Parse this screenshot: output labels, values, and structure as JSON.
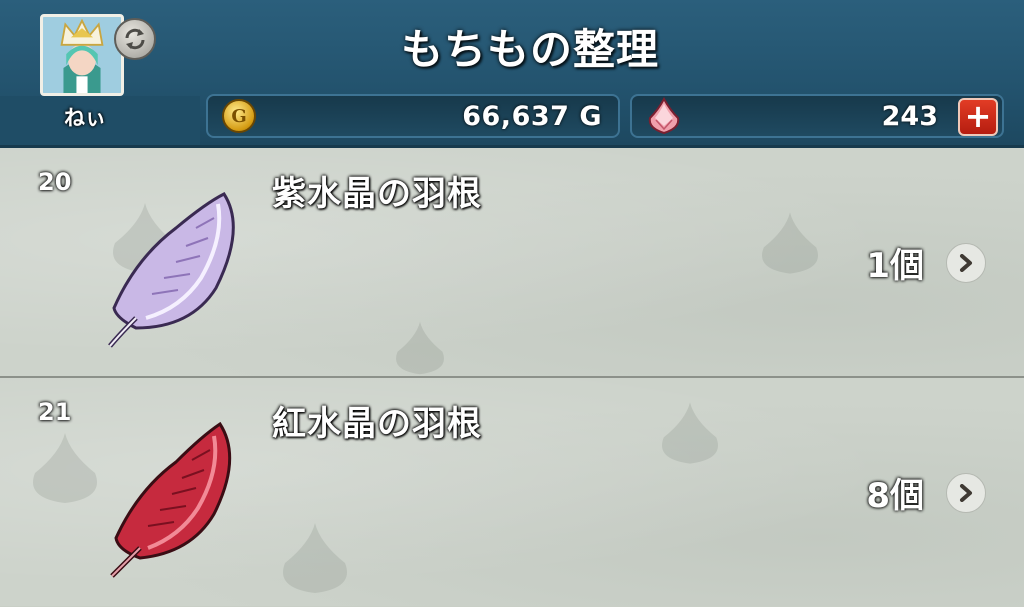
{
  "header": {
    "title": "もちもの整理",
    "player_name": "ねぃ",
    "avatar_icon": "player-avatar",
    "swap_icon": "swap-arrows-icon",
    "gold": {
      "icon": "gold-coin-icon",
      "icon_glyph": "G",
      "value": "66,637 G"
    },
    "gems": {
      "icon": "gem-icon",
      "value": "243",
      "add_label": "+"
    }
  },
  "items": [
    {
      "number": "20",
      "name": "紫水晶の羽根",
      "quantity": "1個",
      "icon": "purple-feather-icon",
      "color": "#b7a3d6"
    },
    {
      "number": "21",
      "name": "紅水晶の羽根",
      "quantity": "8個",
      "icon": "red-feather-icon",
      "color": "#c0283a"
    }
  ],
  "colors": {
    "header_bg": "#23536e",
    "row_bg": "#cdd3cb",
    "plus_button": "#d12d1a"
  }
}
